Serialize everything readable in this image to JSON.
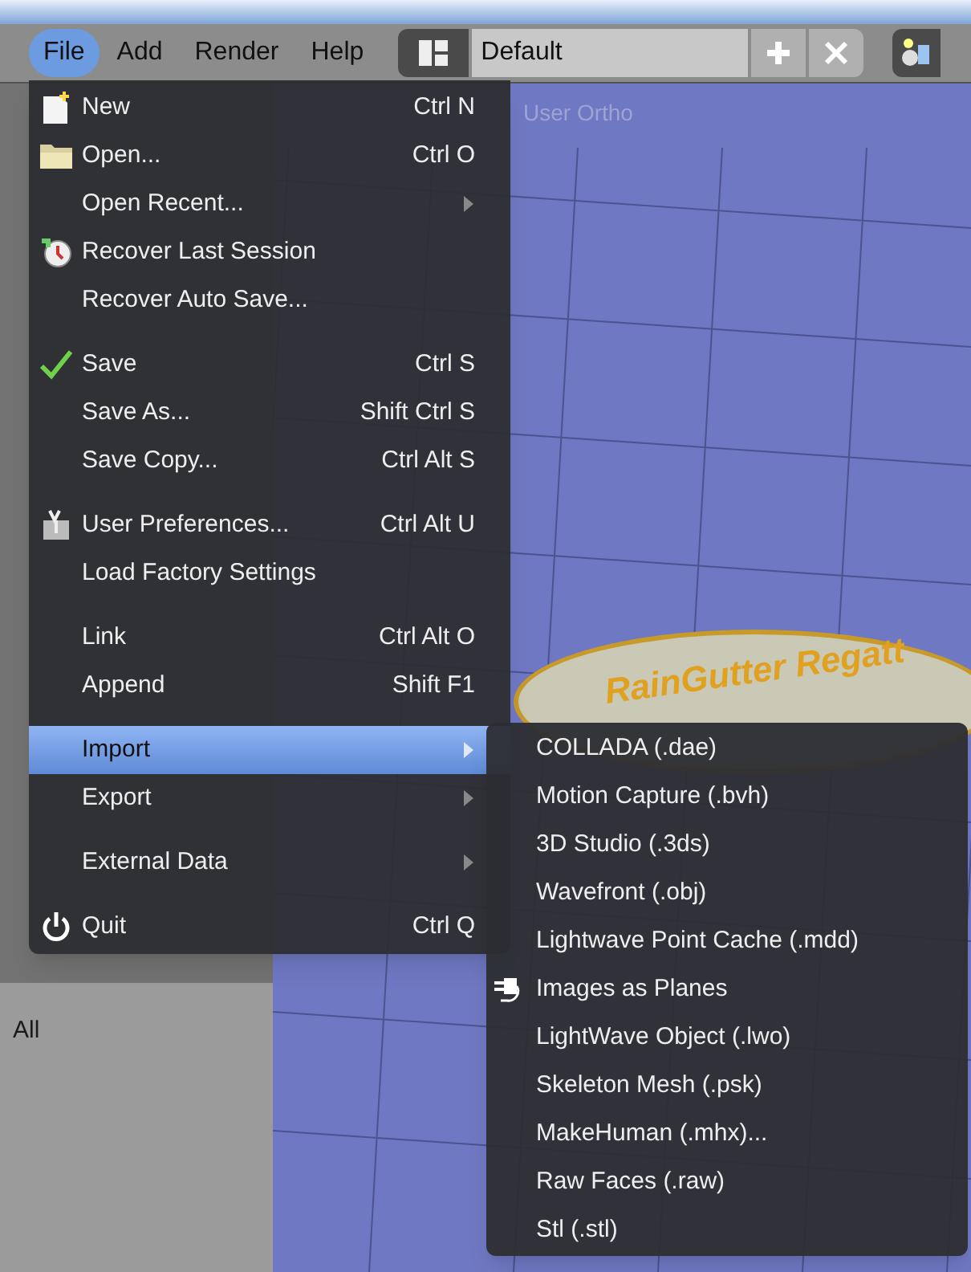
{
  "menu_bar": [
    {
      "label": "File",
      "selected": true
    },
    {
      "label": "Add",
      "selected": false
    },
    {
      "label": "Render",
      "selected": false
    },
    {
      "label": "Help",
      "selected": false
    }
  ],
  "screen_layout": {
    "value": "Default"
  },
  "viewport": {
    "overlay_text": "User Ortho",
    "logo_text": "RainGutter Regatt"
  },
  "tool_panel": {
    "footer_label": "All"
  },
  "file_menu": {
    "groups": [
      [
        {
          "label": "New",
          "shortcut": "Ctrl N",
          "kind": "new",
          "submenu": false,
          "selected": false
        },
        {
          "label": "Open...",
          "shortcut": "Ctrl O",
          "kind": "open",
          "submenu": false,
          "selected": false
        },
        {
          "label": "Open Recent...",
          "kind": "plain",
          "submenu": true,
          "selected": false
        },
        {
          "label": "Recover Last Session",
          "kind": "recover",
          "submenu": false,
          "selected": false
        },
        {
          "label": "Recover Auto Save...",
          "kind": "plain",
          "submenu": false,
          "selected": false
        }
      ],
      [
        {
          "label": "Save",
          "shortcut": "Ctrl S",
          "kind": "save",
          "submenu": false,
          "selected": false
        },
        {
          "label": "Save As...",
          "shortcut": "Shift Ctrl S",
          "kind": "plain",
          "submenu": false,
          "selected": false
        },
        {
          "label": "Save Copy...",
          "shortcut": "Ctrl Alt S",
          "kind": "plain",
          "submenu": false,
          "selected": false
        }
      ],
      [
        {
          "label": "User Preferences...",
          "shortcut": "Ctrl Alt U",
          "kind": "preferences",
          "submenu": false,
          "selected": false
        },
        {
          "label": "Load Factory Settings",
          "kind": "plain",
          "submenu": false,
          "selected": false
        }
      ],
      [
        {
          "label": "Link",
          "shortcut": "Ctrl Alt O",
          "kind": "plain",
          "submenu": false,
          "selected": false
        },
        {
          "label": "Append",
          "shortcut": "Shift F1",
          "kind": "plain",
          "submenu": false,
          "selected": false
        }
      ],
      [
        {
          "label": "Import",
          "kind": "plain",
          "submenu": true,
          "selected": true
        },
        {
          "label": "Export",
          "kind": "plain",
          "submenu": true,
          "selected": false
        }
      ],
      [
        {
          "label": "External Data",
          "kind": "plain",
          "submenu": true,
          "selected": false
        }
      ],
      [
        {
          "label": "Quit",
          "shortcut": "Ctrl Q",
          "kind": "quit",
          "submenu": false,
          "selected": false
        }
      ]
    ]
  },
  "import_menu": {
    "items": [
      {
        "label": "COLLADA (.dae)",
        "kind": "plain"
      },
      {
        "label": "Motion Capture (.bvh)",
        "kind": "plain"
      },
      {
        "label": "3D Studio (.3ds)",
        "kind": "plain"
      },
      {
        "label": "Wavefront (.obj)",
        "kind": "plain"
      },
      {
        "label": "Lightwave Point Cache (.mdd)",
        "kind": "plain"
      },
      {
        "label": "Images as Planes",
        "kind": "addon"
      },
      {
        "label": "LightWave Object (.lwo)",
        "kind": "plain"
      },
      {
        "label": "Skeleton Mesh (.psk)",
        "kind": "plain"
      },
      {
        "label": "MakeHuman (.mhx)...",
        "kind": "plain"
      },
      {
        "label": "Raw Faces (.raw)",
        "kind": "plain"
      },
      {
        "label": "Stl (.stl)",
        "kind": "plain"
      }
    ]
  }
}
